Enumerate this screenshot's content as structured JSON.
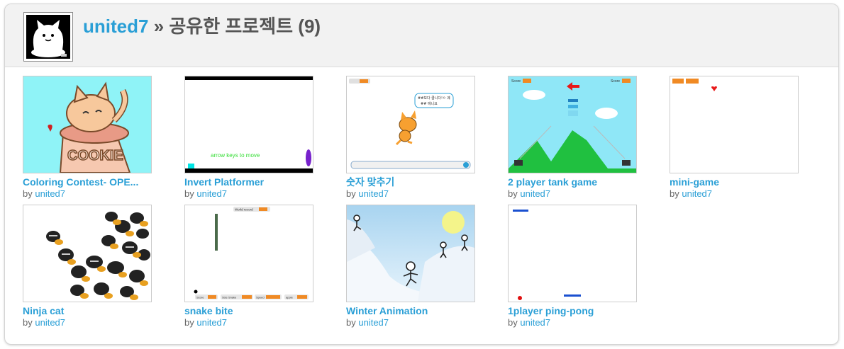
{
  "header": {
    "username": "united7",
    "separator": "»",
    "section_title": "공유한 프로젝트",
    "count": "(9)"
  },
  "projects": [
    {
      "title": "Coloring Contest- OPE...",
      "by": "by",
      "author": "united7"
    },
    {
      "title": "Invert Platformer",
      "by": "by",
      "author": "united7",
      "thumb_text": "arrow keys to move"
    },
    {
      "title": "숫자 맞추기",
      "by": "by",
      "author": "united7",
      "thumb_bubble": "##보다 큽니다!ㅇ 궤 ## 에니요"
    },
    {
      "title": "2 player tank game",
      "by": "by",
      "author": "united7",
      "thumb_label_a": "Score",
      "thumb_label_b": "Score"
    },
    {
      "title": "mini-game",
      "by": "by",
      "author": "united7"
    },
    {
      "title": "Ninja cat",
      "by": "by",
      "author": "united7"
    },
    {
      "title": "snake bite",
      "by": "by",
      "author": "united7",
      "thumb_top": "World record",
      "thumb_bottom": [
        "Score",
        "Size Snake",
        "Speed",
        "apple"
      ]
    },
    {
      "title": "Winter Animation",
      "by": "by",
      "author": "united7"
    },
    {
      "title": "1player ping-pong",
      "by": "by",
      "author": "united7"
    }
  ],
  "colors": {
    "link": "#2a9fd6",
    "header_bg": "#f2f2f2",
    "text_gray": "#555555"
  }
}
